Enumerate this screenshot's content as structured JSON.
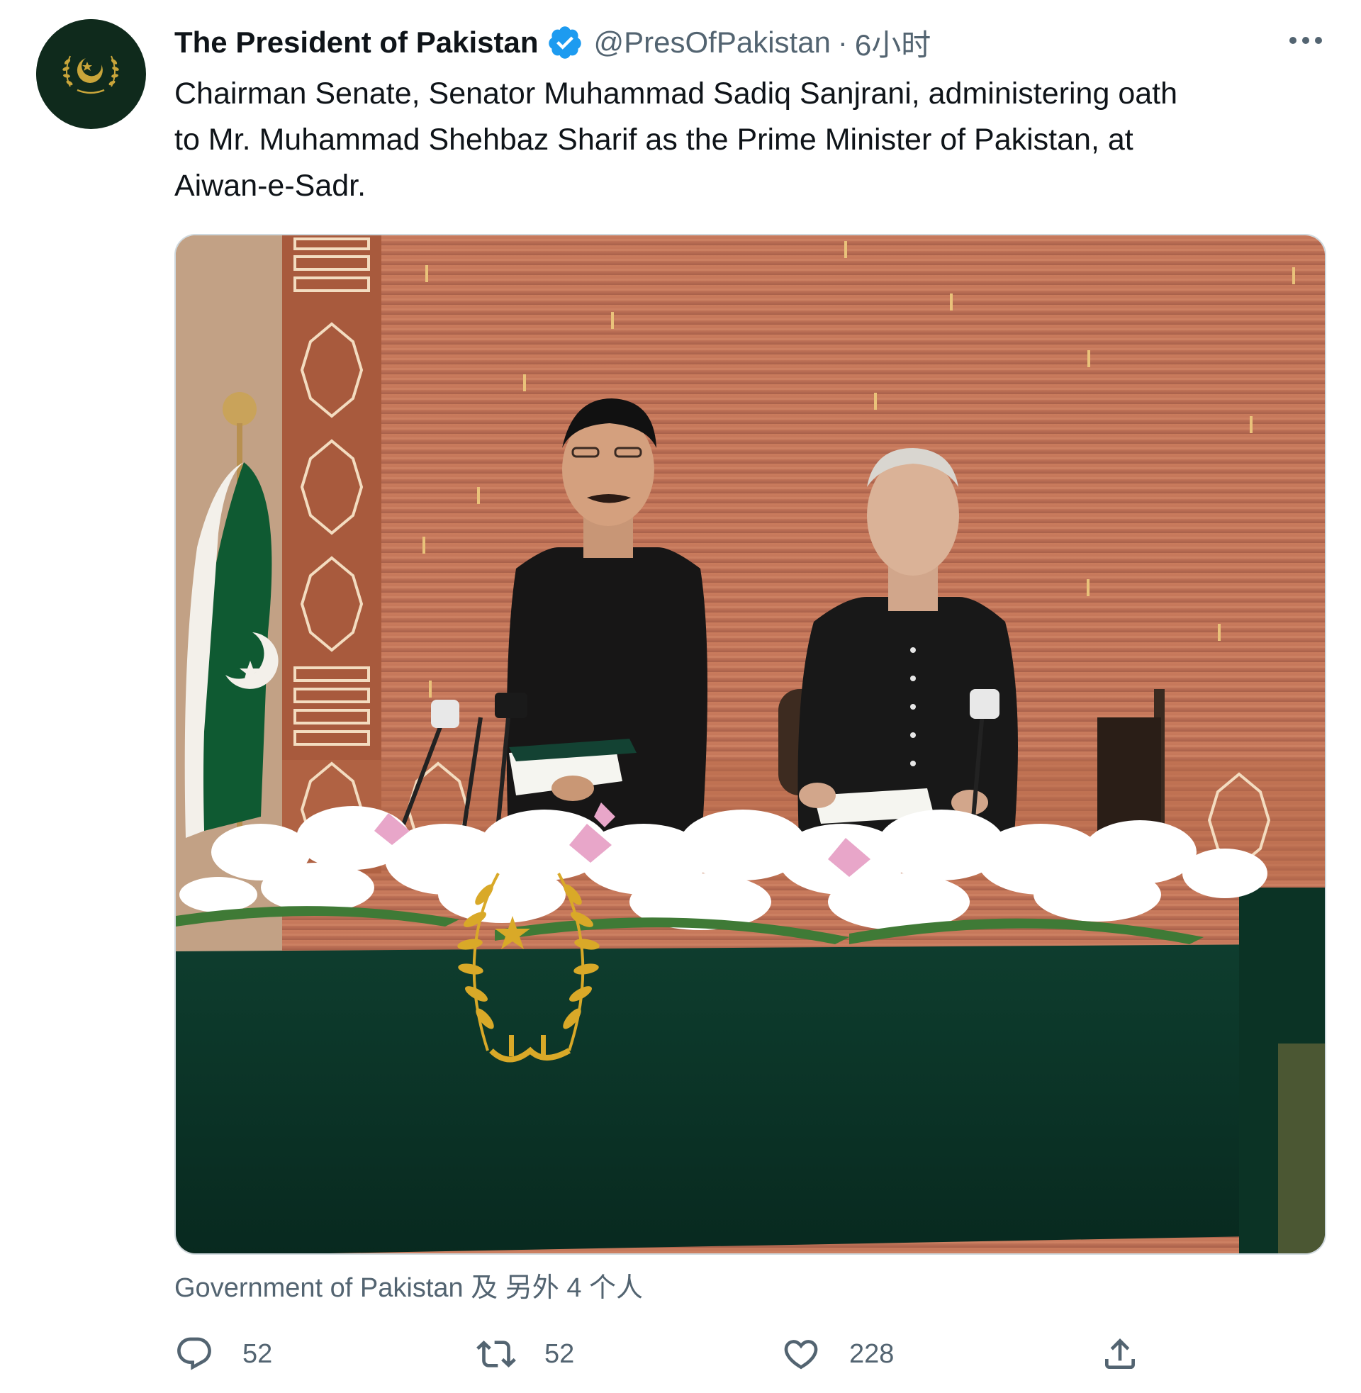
{
  "author": {
    "display_name": "The President of Pakistan",
    "handle": "@PresOfPakistan",
    "separator": "·",
    "time": "6小时",
    "verified_icon": "verified-badge-icon",
    "avatar_icon": "crescent-wreath-emblem"
  },
  "tweet": {
    "text": "Chairman Senate, Senator Muhammad Sadiq Sanjrani, administering oath\nto Mr. Muhammad Shehbaz Sharif as the Prime Minister of Pakistan, at\nAiwan-e-Sadr."
  },
  "media": {
    "photo_icon": "oath-ceremony-photo"
  },
  "tagged": {
    "text": "Government of Pakistan 及 另外 4 个人"
  },
  "actions": {
    "reply_count": "52",
    "retweet_count": "52",
    "like_count": "228"
  },
  "colors": {
    "accent": "#1d9bf0",
    "muted_text": "#536471",
    "avatar_bg": "#0f2a1c",
    "emblem_gold": "#d9a928",
    "table_green": "#0d3a2c"
  }
}
